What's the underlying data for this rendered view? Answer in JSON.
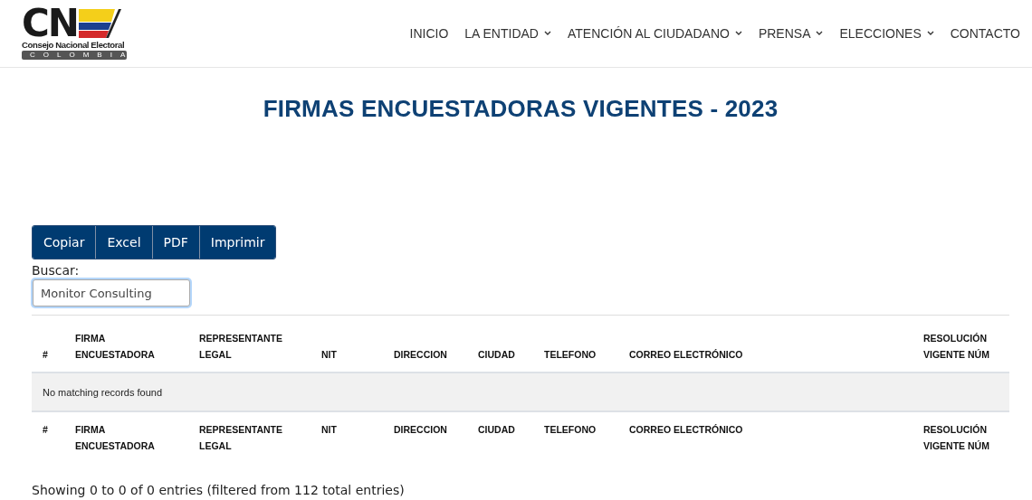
{
  "logo": {
    "mark": "CN",
    "name": "Consejo Nacional Electoral",
    "country": "COLOMBIA"
  },
  "nav": [
    {
      "label": "INICIO",
      "dropdown": false
    },
    {
      "label": "LA ENTIDAD",
      "dropdown": true
    },
    {
      "label": "ATENCIÓN AL CIUDADANO",
      "dropdown": true
    },
    {
      "label": "PRENSA",
      "dropdown": true
    },
    {
      "label": "ELECCIONES",
      "dropdown": true
    },
    {
      "label": "CONTACTO",
      "dropdown": false
    }
  ],
  "title": "FIRMAS ENCUESTADORAS VIGENTES - 2023",
  "export_buttons": [
    "Copiar",
    "Excel",
    "PDF",
    "Imprimir"
  ],
  "search": {
    "label": "Buscar:",
    "value": "Monitor Consulting"
  },
  "table": {
    "columns": [
      "#",
      "FIRMA ENCUESTADORA",
      "REPRESENTANTE LEGAL",
      "NIT",
      "DIRECCION",
      "CIUDAD",
      "TELEFONO",
      "CORREO ELECTRÓNICO",
      "RESOLUCIÓN VIGENTE NÚM"
    ],
    "empty_message": "No matching records found",
    "footer_columns": [
      "#",
      "FIRMA ENCUESTADORA",
      "REPRESENTANTE LEGAL",
      "NIT",
      "DIRECCION",
      "CIUDAD",
      "TELEFONO",
      "CORREO ELECTRÓNICO",
      "RESOLUCIÓN VIGENTE NÚM"
    ]
  },
  "info": "Showing 0 to 0 of 0 entries (filtered from 112 total entries)"
}
